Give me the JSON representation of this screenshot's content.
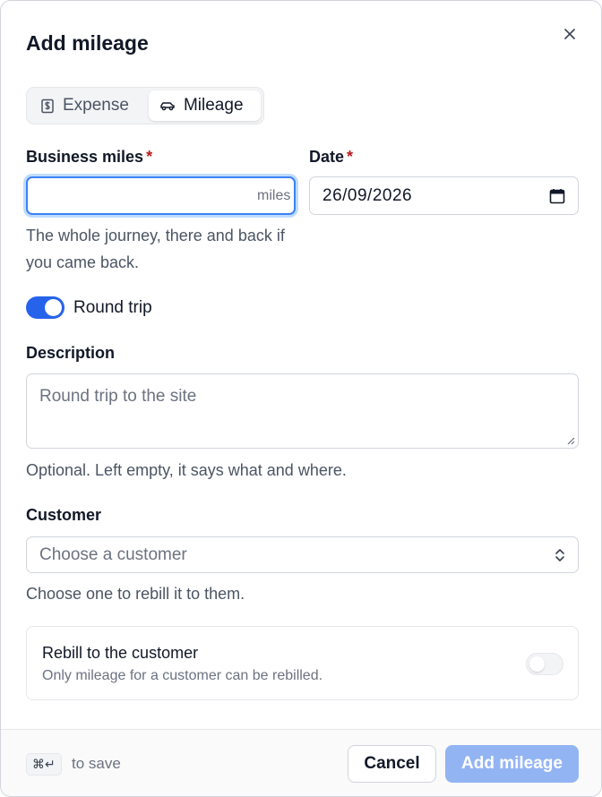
{
  "dialog": {
    "title": "Add mileage",
    "close_icon": "close-icon"
  },
  "tabs": [
    {
      "label": "Expense",
      "icon": "dollar-receipt-icon",
      "active": false
    },
    {
      "label": "Mileage",
      "icon": "car-icon",
      "active": true
    }
  ],
  "business_miles": {
    "label": "Business miles",
    "required_mark": "*",
    "value": "",
    "suffix": "miles",
    "hint": "The whole journey, there and back if you came back."
  },
  "date": {
    "label": "Date",
    "required_mark": "*",
    "value": "26/09/2026",
    "icon": "calendar-icon"
  },
  "round_trip": {
    "label": "Round trip",
    "checked": true
  },
  "description": {
    "label": "Description",
    "placeholder": "Round trip to the site",
    "value": "",
    "hint": "Optional. Left empty, it says what and where."
  },
  "customer": {
    "label": "Customer",
    "placeholder": "Choose a customer",
    "hint": "Choose one to rebill it to them.",
    "icon": "chevron-up-down-icon"
  },
  "rebill": {
    "title": "Rebill to the customer",
    "description": "Only mileage for a customer can be rebilled.",
    "checked": false
  },
  "footer": {
    "shortcut": "⌘↵",
    "shortcut_hint": "to save",
    "cancel_label": "Cancel",
    "submit_label": "Add mileage"
  },
  "colors": {
    "accent": "#2563eb",
    "focus_ring": "#bfdbfe",
    "submit_disabled": "#93b4f3",
    "required": "#b91c1c"
  }
}
